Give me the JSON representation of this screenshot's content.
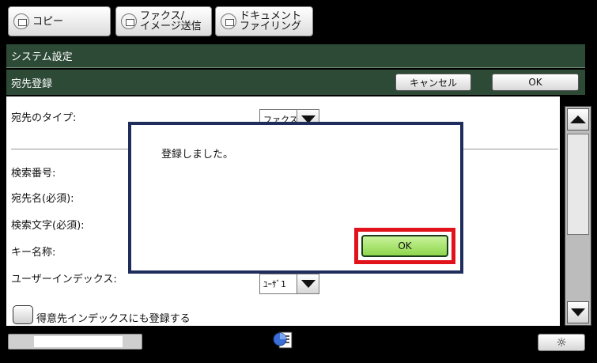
{
  "tabs": [
    {
      "label": "コピー",
      "icon": "copy-icon"
    },
    {
      "label": "ファクス/\nイメージ送信",
      "icon": "fax-icon"
    },
    {
      "label": "ドキュメント\nファイリング",
      "icon": "filing-icon"
    }
  ],
  "header": {
    "system_title": "システム設定",
    "page_title": "宛先登録",
    "cancel_label": "キャンセル",
    "ok_label": "OK"
  },
  "form": {
    "type_label": "宛先のタイプ:",
    "type_value": "ファクス",
    "search_number_label": "検索番号:",
    "name_label": "宛先名(必須):",
    "search_text_label": "検索文字(必須):",
    "key_name_label": "キー名称:",
    "user_index_label": "ユーザーインデックス:",
    "user_index_value": "ﾕｰｻﾞ1",
    "favorite_checkbox_label": "得意先インデックスにも登録する"
  },
  "dialog": {
    "message": "登録しました。",
    "ok_label": "OK"
  },
  "status": {
    "progress_fraction": 0.7
  },
  "colors": {
    "titlebar": "#2d4a36",
    "dialog_border": "#1e2d5c",
    "highlight": "#e0131a",
    "ok_button": "#8fd64d"
  }
}
